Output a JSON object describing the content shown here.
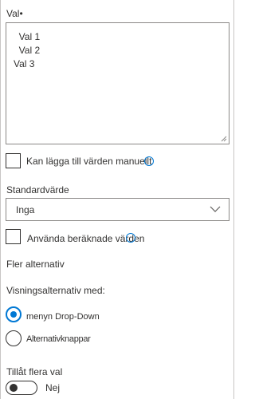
{
  "field": {
    "label": "Val",
    "required_marker": "•",
    "choices": [
      "  Val 1",
      "  Val 2",
      "Val 3"
    ]
  },
  "allow_manual": {
    "label": "Kan lägga till värden manuellt",
    "checked": false
  },
  "default_value": {
    "label": "Standardvärde",
    "selected": "Inga"
  },
  "calculated": {
    "label": "Använda beräknade värden",
    "checked": false
  },
  "more_options": {
    "label": "Fler alternativ"
  },
  "display_choices": {
    "label": "Visningsalternativ med:",
    "options": [
      {
        "label": "menyn Drop-Down",
        "selected": true
      },
      {
        "label": "Alternativknappar",
        "selected": false
      }
    ]
  },
  "multiple": {
    "label": "Tillåt flera val",
    "state_label": "Nej",
    "on": false
  },
  "colors": {
    "accent": "#0078d4",
    "text": "#323130",
    "border": "#8a8886"
  }
}
